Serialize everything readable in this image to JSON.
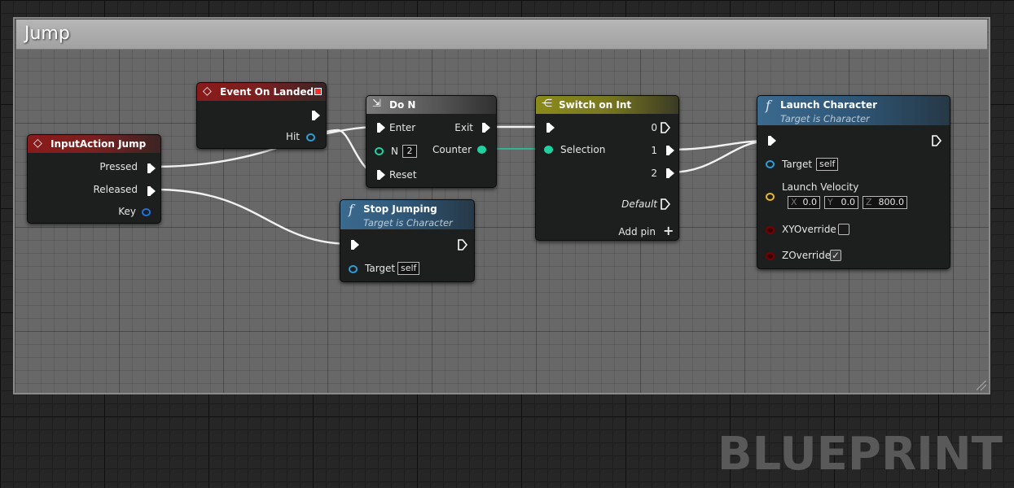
{
  "comment": {
    "title": "Jump"
  },
  "watermark": "BLUEPRINT",
  "colors": {
    "exec": "#ffffff",
    "object": "#2d9cd9",
    "integer": "#20d0a0",
    "vector": "#e8b62d",
    "boolean": "#7a0000",
    "key_struct": "#1e70d8"
  },
  "nodes": {
    "input_action": {
      "title": "InputAction Jump",
      "icon": "diamond-icon",
      "pins": {
        "pressed": "Pressed",
        "released": "Released",
        "key": "Key"
      }
    },
    "event_landed": {
      "title": "Event On Landed",
      "icon": "diamond-icon",
      "pins": {
        "hit": "Hit"
      }
    },
    "do_n": {
      "title": "Do N",
      "icon": "do-n-icon",
      "pins": {
        "enter": "Enter",
        "exit": "Exit",
        "n": "N",
        "n_value": "2",
        "counter": "Counter",
        "reset": "Reset"
      }
    },
    "stop_jumping": {
      "title": "Stop Jumping",
      "subtitle": "Target is Character",
      "icon": "function-icon",
      "pins": {
        "target": "Target",
        "target_value": "self"
      }
    },
    "switch_int": {
      "title": "Switch on Int",
      "icon": "switch-icon",
      "pins": {
        "selection": "Selection",
        "out0": "0",
        "out1": "1",
        "out2": "2",
        "default": "Default",
        "add_pin": "Add pin"
      }
    },
    "launch": {
      "title": "Launch Character",
      "subtitle": "Target is Character",
      "icon": "function-icon",
      "pins": {
        "target": "Target",
        "target_value": "self",
        "velocity": "Launch Velocity",
        "x_axis": "X",
        "x_value": "0.0",
        "y_axis": "Y",
        "y_value": "0.0",
        "z_axis": "Z",
        "z_value": "800.0",
        "xy_override": "XYOverride",
        "xy_override_checked": false,
        "z_override": "ZOverride",
        "z_override_checked": true
      }
    }
  }
}
